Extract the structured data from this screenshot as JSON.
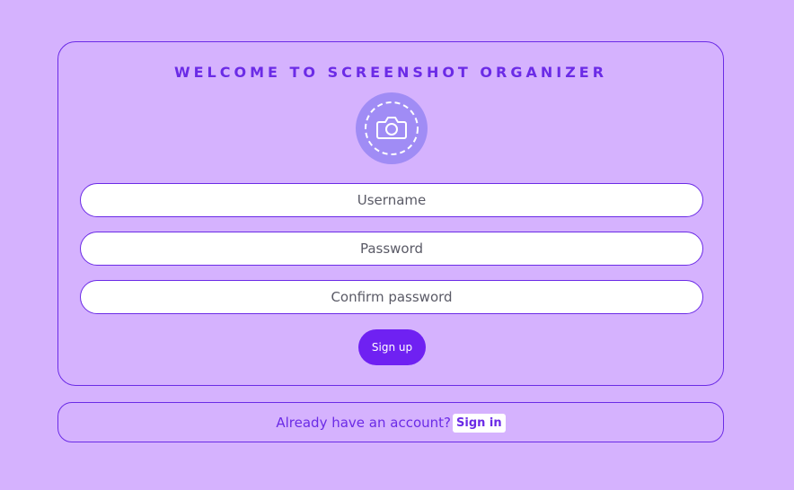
{
  "app": {
    "title": "WELCOME TO SCREENSHOT ORGANIZER",
    "logo_icon": "camera-icon"
  },
  "form": {
    "username_placeholder": "Username",
    "password_placeholder": "Password",
    "confirm_placeholder": "Confirm password",
    "submit_label": "Sign up"
  },
  "footer": {
    "prompt": "Already have an account?",
    "link_label": "Sign in"
  },
  "colors": {
    "background": "#d5b2fe",
    "accent": "#6b2be6",
    "button": "#6f21f2",
    "logo_circle": "#a08cf5"
  }
}
